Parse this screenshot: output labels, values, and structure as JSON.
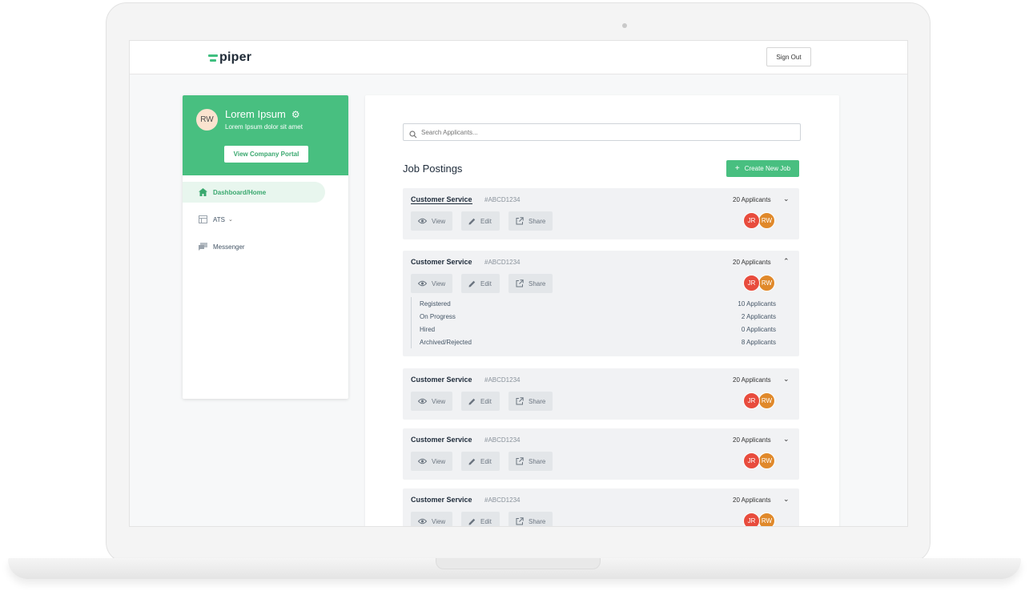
{
  "app": {
    "logo_text": "piper",
    "signout_label": "Sign Out",
    "brand_color": "#48bf80"
  },
  "profile": {
    "initials": "RW",
    "name": "Lorem Ipsum",
    "subtitle": "Lorem Ipsum dolor sit amet",
    "portal_button": "View Company Portal"
  },
  "nav": {
    "items": [
      {
        "label": "Dashboard/Home",
        "icon": "home-icon",
        "active": true
      },
      {
        "label": "ATS",
        "icon": "table-icon",
        "active": false
      },
      {
        "label": "Messenger",
        "icon": "chat-icon",
        "active": false
      }
    ]
  },
  "search": {
    "placeholder": "Search Applicants..."
  },
  "jobs": {
    "title": "Job Postings",
    "create_label": "Create New Job",
    "actions": {
      "view": "View",
      "edit": "Edit",
      "share": "Share"
    },
    "avatars": [
      "JR",
      "RW"
    ],
    "list": [
      {
        "title": "Customer Service",
        "id": "#ABCD1234",
        "count": "20 Applicants",
        "expanded": false
      },
      {
        "title": "Customer Service",
        "id": "#ABCD1234",
        "count": "20 Applicants",
        "expanded": true,
        "stats": [
          {
            "label": "Registered",
            "value": "10 Applicants"
          },
          {
            "label": "On Progress",
            "value": "2 Applicants"
          },
          {
            "label": "Hired",
            "value": "0 Applicants"
          },
          {
            "label": "Archived/Rejected",
            "value": "8 Applicants"
          }
        ]
      },
      {
        "title": "Customer Service",
        "id": "#ABCD1234",
        "count": "20 Applicants",
        "expanded": false
      },
      {
        "title": "Customer Service",
        "id": "#ABCD1234",
        "count": "20 Applicants",
        "expanded": false
      },
      {
        "title": "Customer Service",
        "id": "#ABCD1234",
        "count": "20 Applicants",
        "expanded": false
      }
    ]
  }
}
